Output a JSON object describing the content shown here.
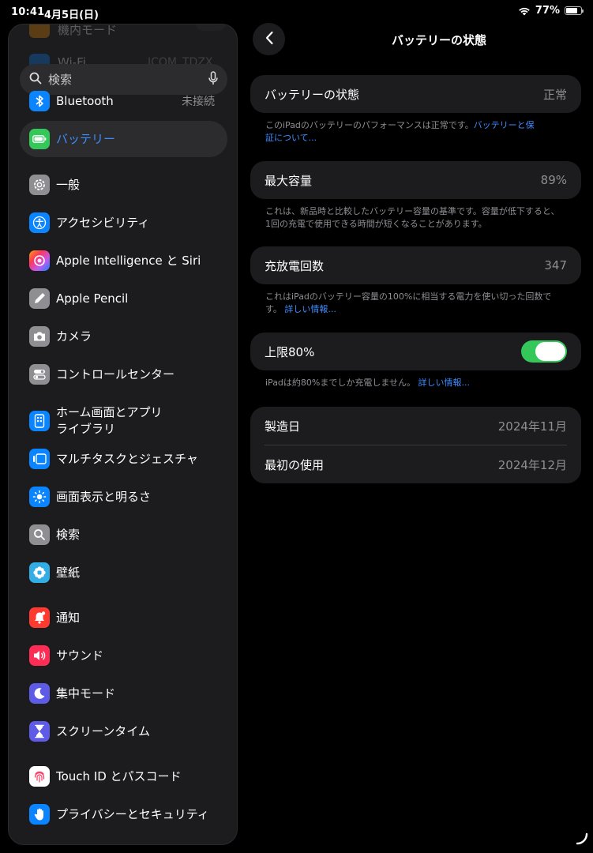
{
  "status": {
    "time": "10:41",
    "date": "4月5日(日)",
    "battery_percent": "77%",
    "battery_level": 0.77
  },
  "sidebar": {
    "search_placeholder": "検索",
    "faded_top": [
      {
        "label": "機内モード",
        "value": ""
      },
      {
        "label": "Wi-Fi",
        "value": "ICOM_TDZX"
      }
    ],
    "bluetooth": {
      "label": "Bluetooth",
      "value": "未接続"
    },
    "items": [
      {
        "label": "バッテリー",
        "icon": "battery-icon",
        "color": "#34c759"
      },
      {
        "label": "一般",
        "icon": "gear-icon",
        "color": "#8e8e93"
      },
      {
        "label": "アクセシビリティ",
        "icon": "accessibility-icon",
        "color": "#0a84ff"
      },
      {
        "label": "Apple Intelligence と Siri",
        "icon": "siri-icon",
        "color": "#ff6b9d"
      },
      {
        "label": "Apple Pencil",
        "icon": "pencil-icon",
        "color": "#8e8e93"
      },
      {
        "label": "カメラ",
        "icon": "camera-icon",
        "color": "#8e8e93"
      },
      {
        "label": "コントロールセンター",
        "icon": "control-center-icon",
        "color": "#8e8e93"
      },
      {
        "label": "ホーム画面とアプリ\nライブラリ",
        "line1": "ホーム画面とアプリ",
        "line2": "ライブラリ",
        "icon": "home-screen-icon",
        "color": "#0a84ff"
      },
      {
        "label": "マルチタスクとジェスチャ",
        "icon": "multitask-icon",
        "color": "#0a84ff"
      },
      {
        "label": "画面表示と明るさ",
        "icon": "brightness-icon",
        "color": "#0a84ff"
      },
      {
        "label": "検索",
        "icon": "search-icon",
        "color": "#8e8e93"
      },
      {
        "label": "壁紙",
        "icon": "wallpaper-icon",
        "color": "#32ade6"
      },
      {
        "label": "通知",
        "icon": "notifications-icon",
        "color": "#ff3b30"
      },
      {
        "label": "サウンド",
        "icon": "sound-icon",
        "color": "#ff2d55"
      },
      {
        "label": "集中モード",
        "icon": "moon-icon",
        "color": "#5e5ce6"
      },
      {
        "label": "スクリーンタイム",
        "icon": "hourglass-icon",
        "color": "#5e5ce6"
      },
      {
        "label": "Touch ID とパスコード",
        "icon": "fingerprint-icon",
        "color": "#ffffff"
      },
      {
        "label": "プライバシーとセキュリティ",
        "icon": "hand-icon",
        "color": "#0a84ff"
      }
    ]
  },
  "detail": {
    "title": "バッテリーの状態",
    "health": {
      "label": "バッテリーの状態",
      "value": "正常"
    },
    "health_note": "このiPadのバッテリーのパフォーマンスは正常です。",
    "health_link_1": "バッテリーと保",
    "health_link_2": "証について...",
    "capacity": {
      "label": "最大容量",
      "value": "89%"
    },
    "capacity_note_1": "これは、新品時と比較したバッテリー容量の基準です。容量が低下すると、",
    "capacity_note_2": "1回の充電で使用できる時間が短くなることがあります。",
    "cycles": {
      "label": "充放電回数",
      "value": "347"
    },
    "cycles_note_1": "これはiPadのバッテリー容量の100%に相当する電力を使い切った回数で",
    "cycles_note_2": "す。",
    "cycles_link": "詳しい情報...",
    "limit": {
      "label": "上限80%",
      "on": true
    },
    "limit_note": "iPadは約80%までしか充電しません。",
    "limit_link": "詳しい情報...",
    "manufacture": {
      "label": "製造日",
      "value": "2024年11月"
    },
    "first_use": {
      "label": "最初の使用",
      "value": "2024年12月"
    }
  }
}
